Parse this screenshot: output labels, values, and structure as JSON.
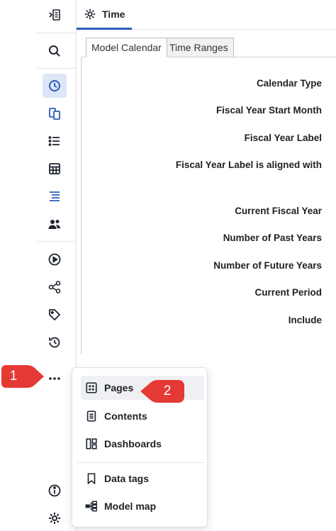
{
  "header": {
    "tab_label": "Time",
    "tab_icon": "gear-icon"
  },
  "subtabs": [
    {
      "label": "Model Calendar",
      "active": true
    },
    {
      "label": "Time Ranges",
      "active": false
    }
  ],
  "fields": [
    "Calendar Type",
    "Fiscal Year Start Month",
    "Fiscal Year Label",
    "Fiscal Year Label is aligned with",
    "Current Fiscal Year",
    "Number of Past Years",
    "Number of Future Years",
    "Current Period",
    "Include"
  ],
  "rail": {
    "icons": [
      "expand-sidebar-icon",
      "search-icon",
      "time-icon",
      "copy-icon",
      "list-icon",
      "grid-icon",
      "lines-icon",
      "users-icon",
      "play-icon",
      "share-icon",
      "tag-icon",
      "history-icon",
      "more-icon",
      "info-icon",
      "settings-icon"
    ],
    "active": "time-icon"
  },
  "menu": {
    "items": [
      {
        "label": "Pages",
        "icon": "pages-icon"
      },
      {
        "label": "Contents",
        "icon": "contents-icon"
      },
      {
        "label": "Dashboards",
        "icon": "dashboards-icon"
      },
      {
        "label": "Data tags",
        "icon": "bookmark-icon"
      },
      {
        "label": "Model map",
        "icon": "model-map-icon"
      }
    ]
  },
  "callouts": [
    "1",
    "2"
  ],
  "colors": {
    "accent": "#2f5bb8",
    "active_bg": "#dde6f6",
    "callout": "#e53935",
    "icon": "#1f2430"
  }
}
